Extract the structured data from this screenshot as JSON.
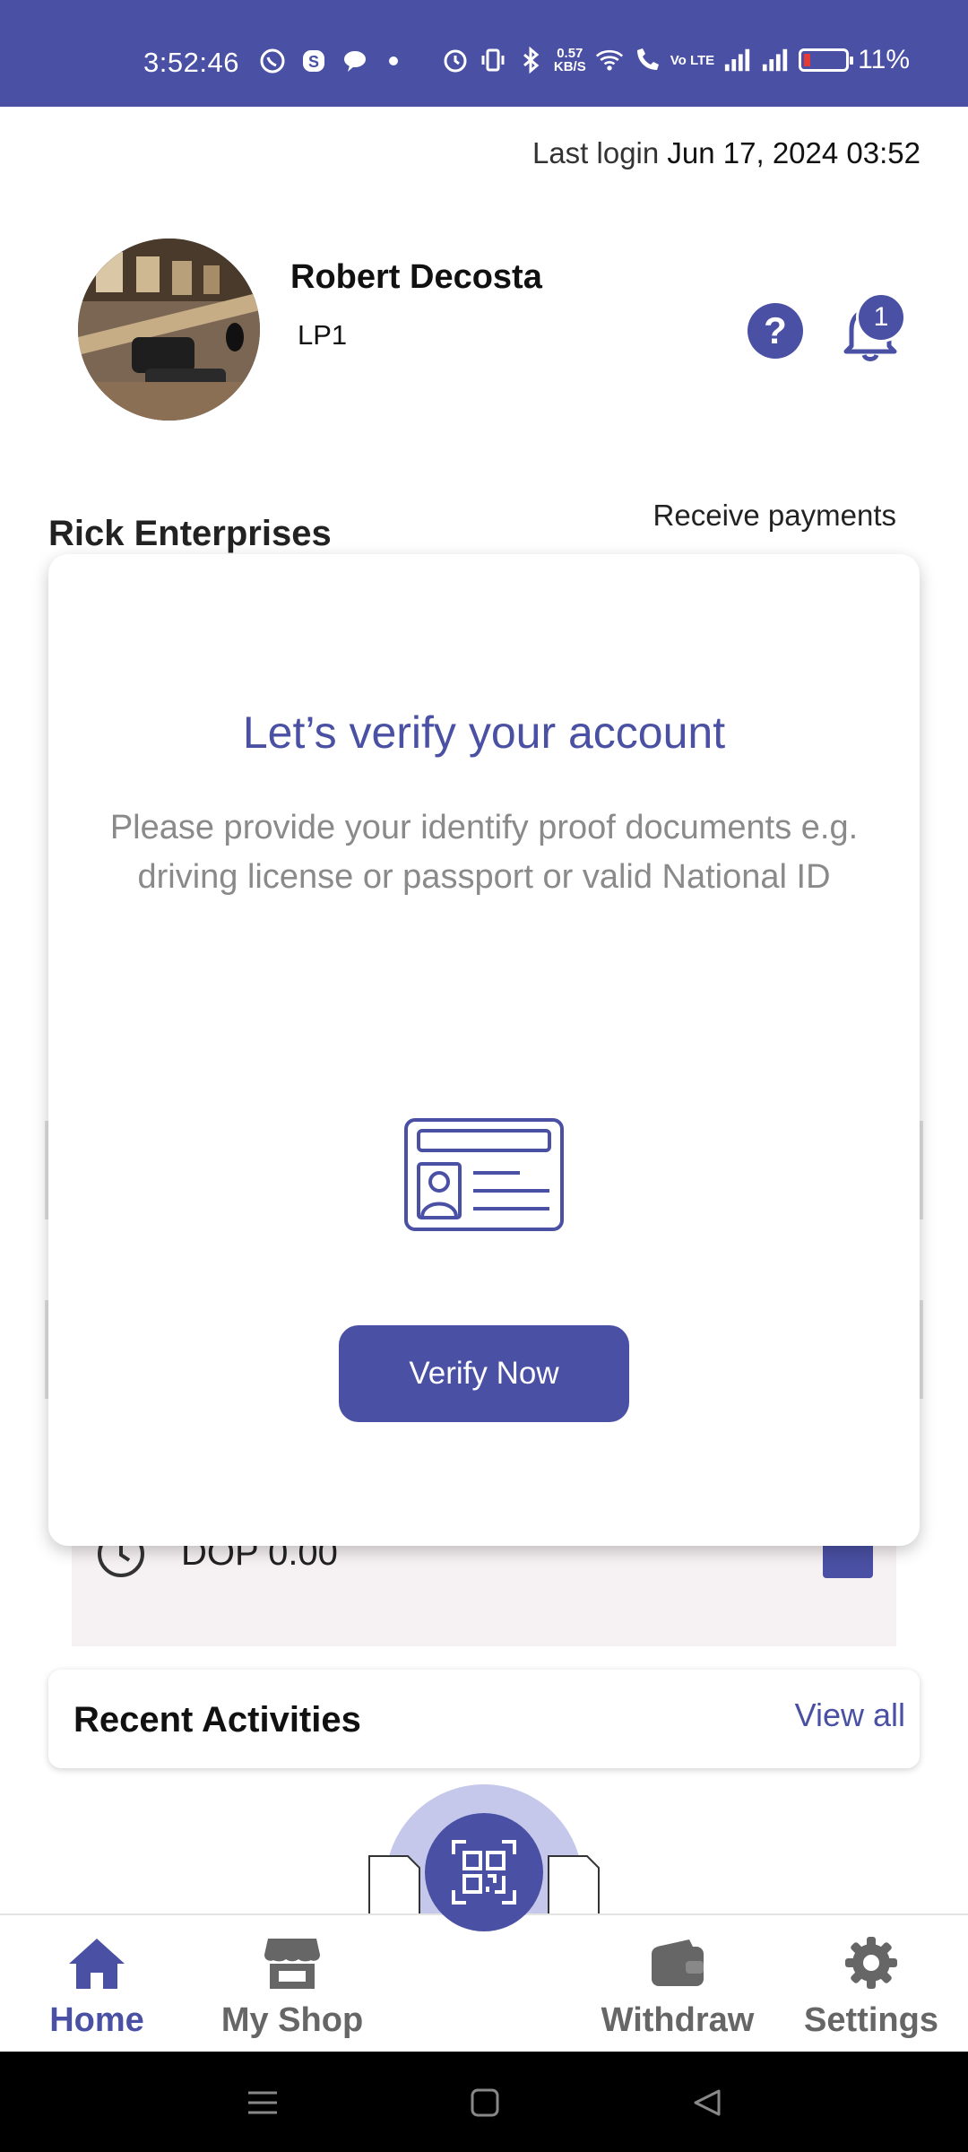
{
  "status_bar": {
    "time": "3:52:46",
    "net_speed_value": "0.57",
    "net_speed_unit": "KB/S",
    "volte": "Vo LTE",
    "battery_percent": "11%",
    "battery_level": 0.11
  },
  "header": {
    "last_login_label": "Last login",
    "last_login_value": "Jun 17, 2024 03:52",
    "user_name": "Robert Decosta",
    "user_code": "LP1",
    "help_symbol": "?",
    "notification_count": "1"
  },
  "business": {
    "name": "Rick Enterprises",
    "receive_payments_label": "Receive payments"
  },
  "modal": {
    "title": "Let’s verify your account",
    "description": "Please provide your identify proof documents e.g. driving license or passport or valid National ID",
    "button_label": "Verify Now",
    "icon": "id-card-icon"
  },
  "balance": {
    "value": "DOP 0.00"
  },
  "recent_activities": {
    "title": "Recent Activities",
    "view_all_label": "View all"
  },
  "bottom_nav": {
    "items": [
      {
        "label": "Home",
        "icon": "home-icon",
        "active": true
      },
      {
        "label": "My Shop",
        "icon": "shop-icon",
        "active": false
      },
      {
        "label": "Withdraw",
        "icon": "wallet-icon",
        "active": false
      },
      {
        "label": "Settings",
        "icon": "gear-icon",
        "active": false
      }
    ],
    "fab_icon": "qr-code-icon"
  },
  "colors": {
    "primary": "#4a50a3",
    "text_muted": "#8a8a8a",
    "nav_inactive": "#666666"
  }
}
